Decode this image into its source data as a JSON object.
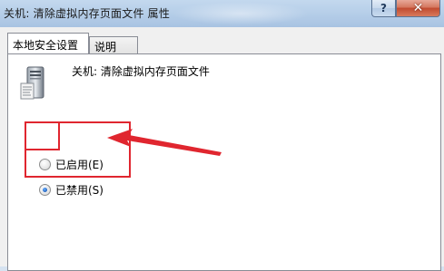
{
  "window": {
    "title": "关机: 清除虚拟内存页面文件 属性",
    "help_label": "?",
    "close_label": "✕"
  },
  "tabs": [
    {
      "label": "本地安全设置",
      "active": true
    },
    {
      "label": "说明",
      "active": false
    }
  ],
  "policy": {
    "name": "关机: 清除虚拟内存页面文件",
    "icon": "server-policy-icon"
  },
  "options": {
    "enabled_label": "已启用(E)",
    "disabled_label": "已禁用(S)",
    "selected": "disabled"
  },
  "annotation_color": "#e0262f"
}
